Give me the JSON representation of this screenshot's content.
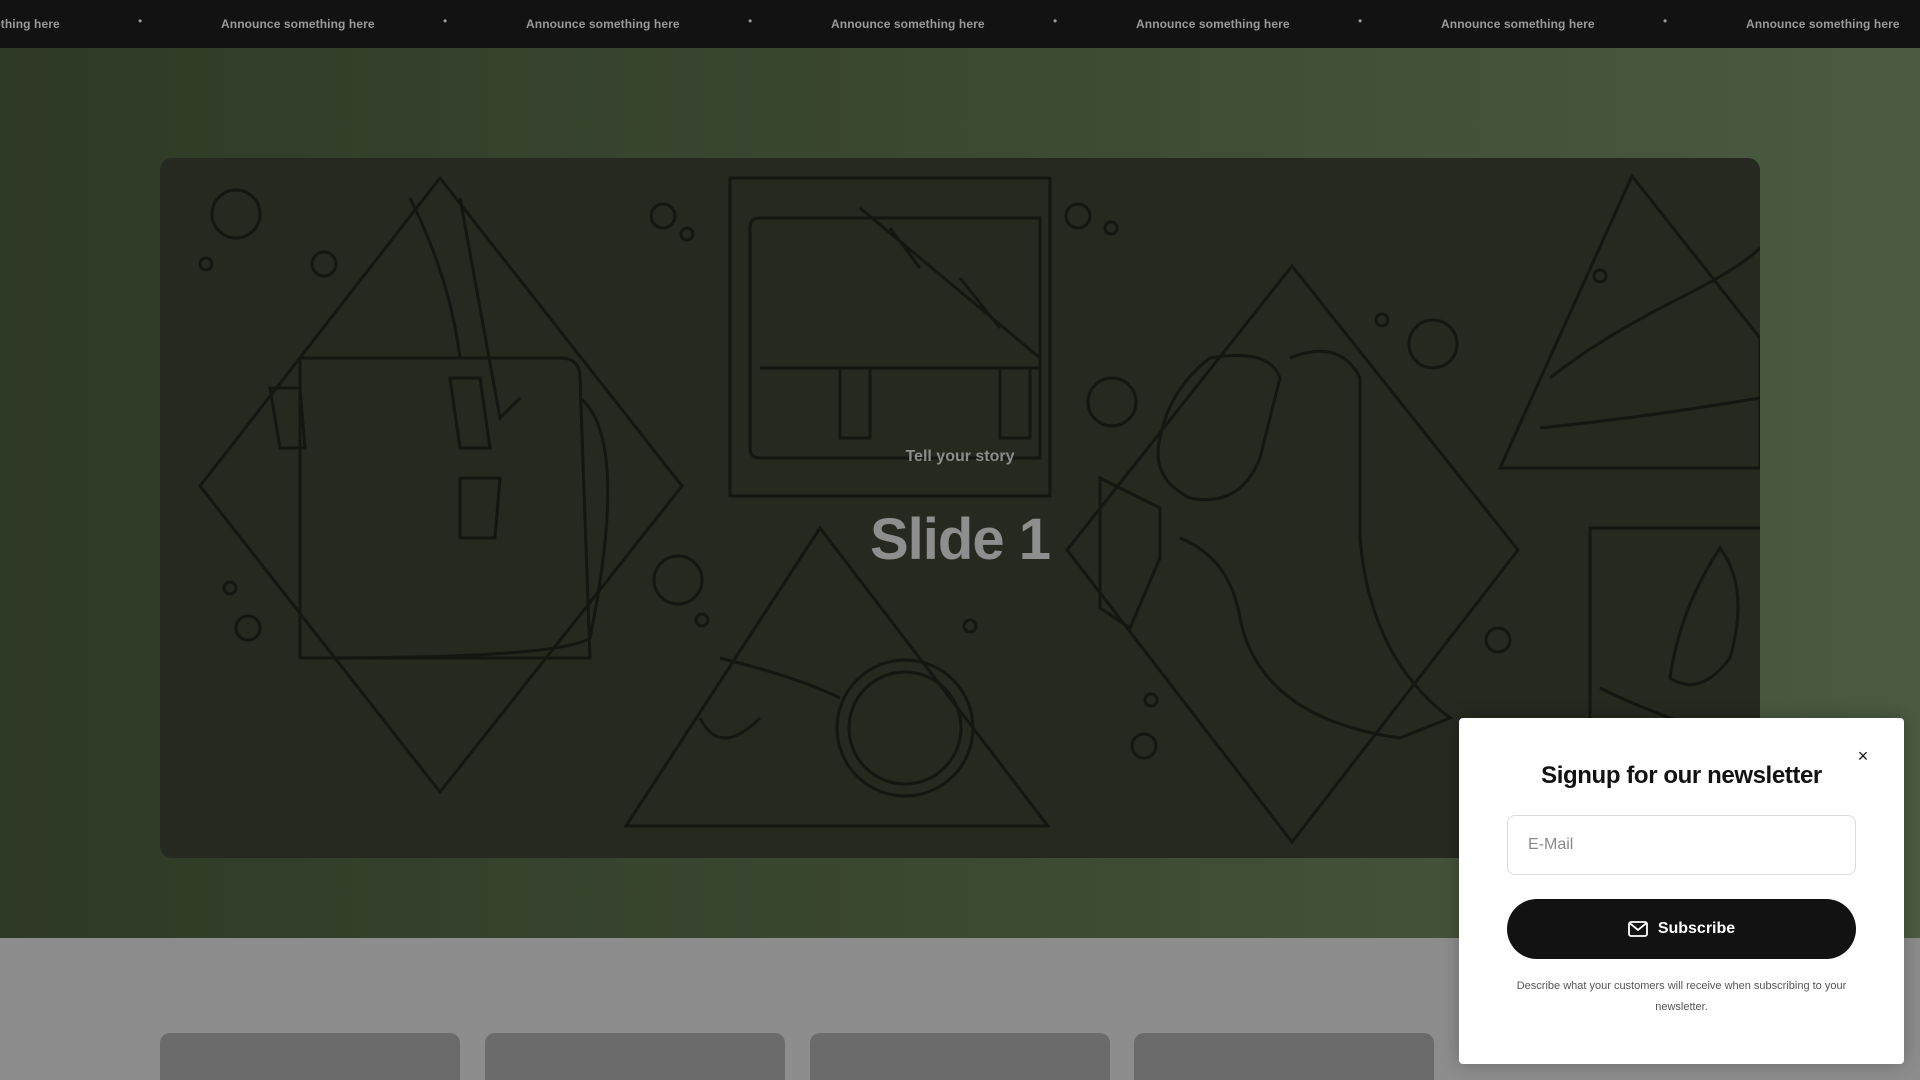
{
  "announcement": {
    "text": "Announce something here",
    "separator": "•",
    "partial_text": "ething here"
  },
  "hero": {
    "subheading": "Tell your story",
    "heading": "Slide 1"
  },
  "newsletter": {
    "title": "Signup for our newsletter",
    "close_icon": "×",
    "email_placeholder": "E-Mail",
    "email_value": "",
    "subscribe_label": "Subscribe",
    "description": "Describe what your customers will receive when subscribing to your newsletter."
  },
  "colors": {
    "announcement_bg": "#121212",
    "hero_bg": "#3a4731",
    "slide_bg": "#25291f",
    "button_bg": "#121212",
    "card_bg": "#6b6b6b"
  }
}
